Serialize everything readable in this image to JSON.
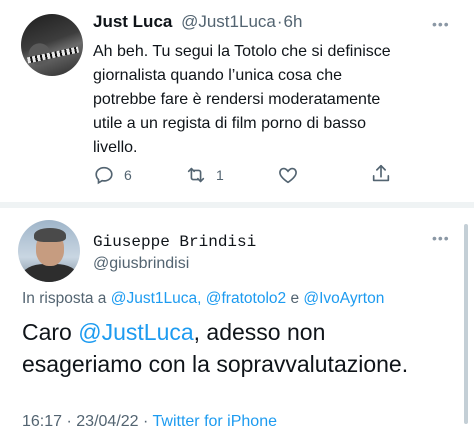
{
  "tweet1": {
    "name": "Just Luca",
    "handle": "@Just1Luca",
    "sep": "·",
    "time": "6h",
    "more": "•••",
    "text_lines": [
      "Ah beh. Tu segui la Totolo che si definisce",
      "giornalista quando l’unica cosa che",
      "potrebbe fare è rendersi moderatamente",
      "utile a un regista di film porno di basso",
      "livello."
    ],
    "reply_count": "6",
    "retweet_count": "1",
    "icons": [
      "reply-icon",
      "retweet-icon",
      "like-icon",
      "share-icon"
    ]
  },
  "tweet2": {
    "name": "Giuseppe Brindisi",
    "handle": "@giusbrindisi",
    "more": "•••",
    "reply_prefix": "In risposta a",
    "reply_mentions": [
      "@Just1Luca,",
      "@fratotolo2",
      "@IvoAyrton"
    ],
    "reply_and": "e",
    "text_mention": "@JustLuca",
    "text_line1_rest": ", adesso non",
    "text_line2": "esageriamo con la sopravvalutazione.",
    "time": "16:17",
    "sep1": "·",
    "date": "23/04/22",
    "sep2": "·",
    "source": "Twitter for iPhone"
  },
  "colors": {
    "accent": "#1d9bf0",
    "secondary_text": "#536471",
    "primary_text": "#0f1419",
    "divider": "#eff3f4"
  }
}
